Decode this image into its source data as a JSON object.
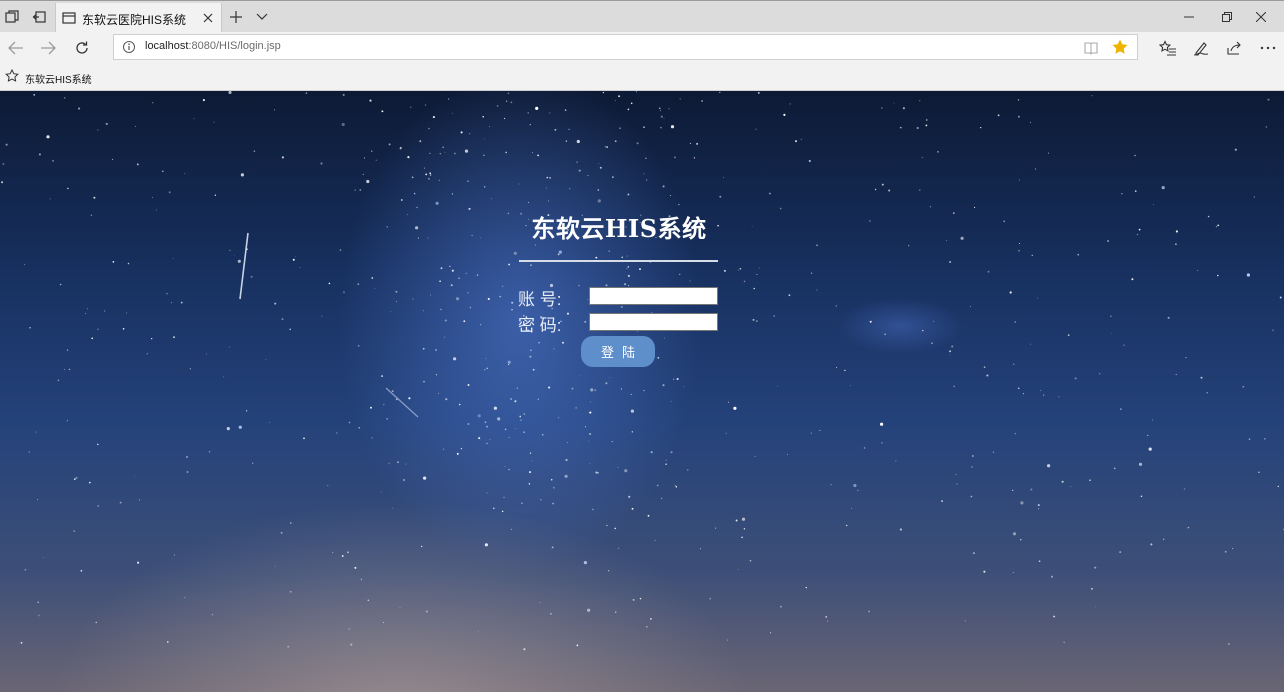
{
  "browser": {
    "tab_title": "东软云医院HIS系统",
    "url_host": "localhost",
    "url_rest": ":8080/HIS/login.jsp",
    "favorites": [
      {
        "label": "东软云HIS系统"
      }
    ]
  },
  "login": {
    "title": "东软云HIS系统",
    "account_label": "账  号:",
    "account_value": "",
    "password_label": "密  码:",
    "password_value": "",
    "submit_label": "登陆"
  },
  "colors": {
    "button": "#5f8fcb",
    "favorite_star": "#f0b400"
  }
}
